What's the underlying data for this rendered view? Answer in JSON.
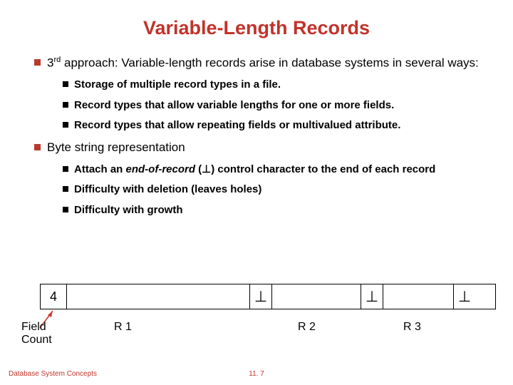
{
  "title": "Variable-Length Records",
  "bullets": {
    "b1_pre": "3",
    "b1_sup": "rd",
    "b1_post": " approach: Variable-length records arise in database systems in several ways:",
    "b1_sub": [
      "Storage of multiple record types in a file.",
      "Record types that allow variable lengths for one or more fields.",
      "Record types that allow repeating fields or multivalued attribute."
    ],
    "b2": "Byte string representation",
    "b2_sub1_pre": "Attach an ",
    "b2_sub1_em": "end-of-record",
    "b2_sub1_post": " (⊥) control character to the end of each record",
    "b2_sub2": "Difficulty with deletion (leaves holes)",
    "b2_sub3": "Difficulty with growth"
  },
  "diagram": {
    "count": "4",
    "perp": "⊥",
    "field_count": "Field\nCount",
    "r1": "R 1",
    "r2": "R 2",
    "r3": "R 3"
  },
  "footer": {
    "left": "Database System Concepts",
    "center": "11. 7"
  }
}
